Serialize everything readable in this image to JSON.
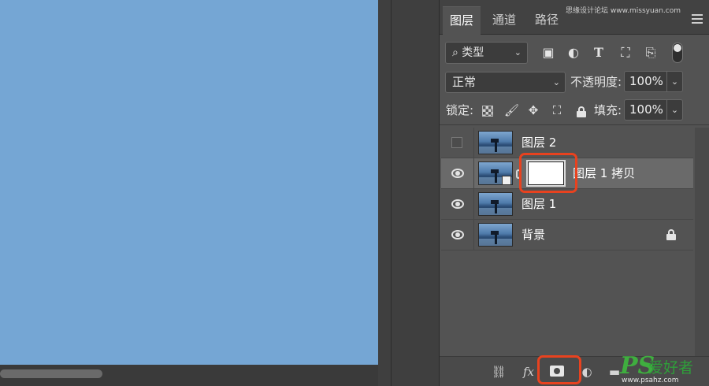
{
  "panel": {
    "tabs": [
      "图层",
      "通道",
      "路径"
    ],
    "active_tab": "图层",
    "watermark_top": "思缘设计论坛  www.missyuan.com"
  },
  "filter": {
    "label": "类型",
    "icons": [
      "image-filter-icon",
      "adjustment-filter-icon",
      "type-filter-icon",
      "shape-filter-icon",
      "smartobject-filter-icon"
    ]
  },
  "blend": {
    "mode": "正常",
    "opacity_label": "不透明度:",
    "opacity_value": "100%"
  },
  "lock": {
    "label": "锁定:",
    "fill_label": "填充:",
    "fill_value": "100%"
  },
  "layers": [
    {
      "name": "图层 2",
      "visible": false,
      "selected": false,
      "has_mask": false,
      "locked": false
    },
    {
      "name": "图层 1 拷贝",
      "visible": true,
      "selected": true,
      "has_mask": true,
      "locked": false
    },
    {
      "name": "图层 1",
      "visible": true,
      "selected": false,
      "has_mask": false,
      "locked": false
    },
    {
      "name": "背景",
      "visible": true,
      "selected": false,
      "has_mask": false,
      "locked": true
    }
  ],
  "bottom_icons": [
    "link-icon",
    "fx-icon",
    "add-mask-icon",
    "adjustment-icon",
    "folder-icon",
    "new-layer-icon",
    "trash-icon"
  ],
  "colors": {
    "canvas": "#75a6d4",
    "highlight": "#e8421f",
    "panel": "#535353",
    "selected_row": "#6a6a6a"
  },
  "watermark": {
    "ps": "PS",
    "cn": "爱好者",
    "url": "www.psahz.com"
  }
}
